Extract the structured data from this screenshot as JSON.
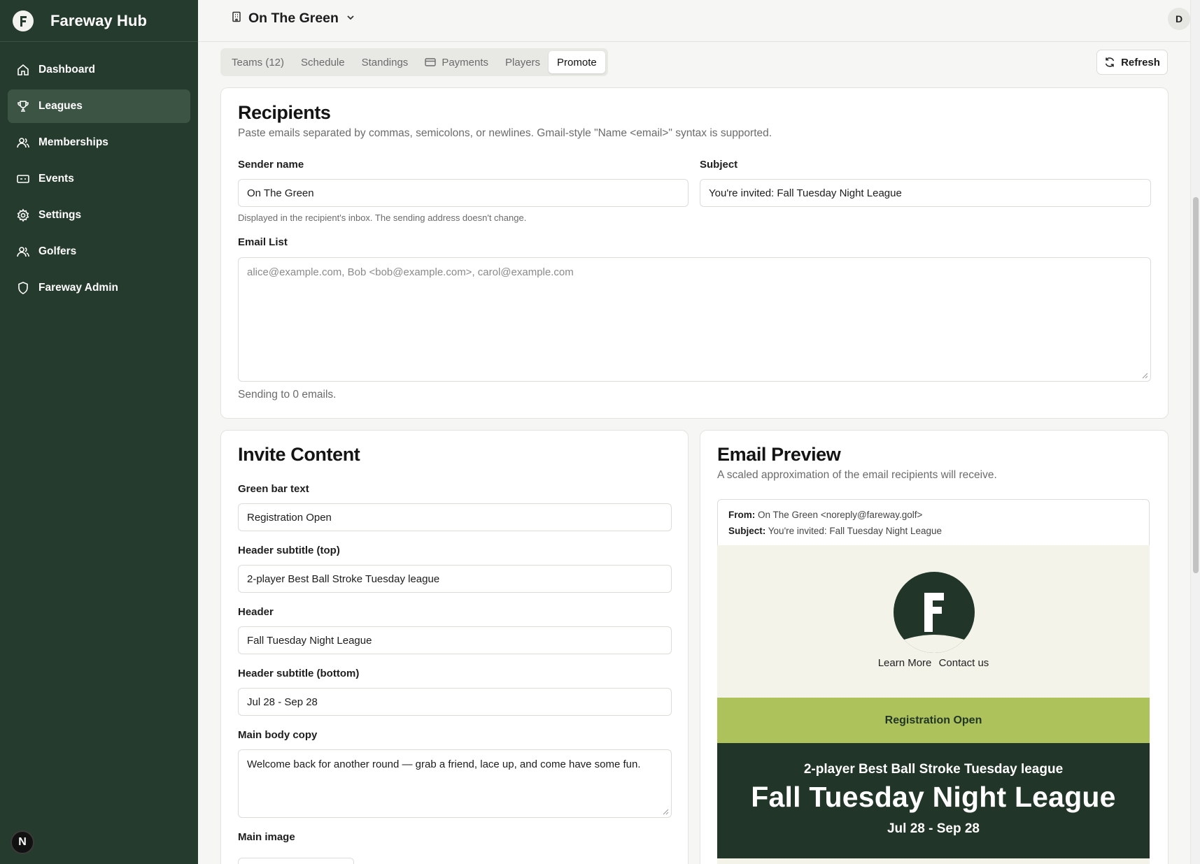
{
  "brand": {
    "name": "Fareway Hub",
    "logo_letter": "F"
  },
  "sidebar": {
    "items": [
      {
        "label": "Dashboard",
        "icon": "home-icon",
        "active": false
      },
      {
        "label": "Leagues",
        "icon": "trophy-icon",
        "active": true
      },
      {
        "label": "Memberships",
        "icon": "users-icon",
        "active": false
      },
      {
        "label": "Events",
        "icon": "ticket-icon",
        "active": false
      },
      {
        "label": "Settings",
        "icon": "gear-icon",
        "active": false
      },
      {
        "label": "Golfers",
        "icon": "users-icon",
        "active": false
      },
      {
        "label": "Fareway Admin",
        "icon": "shield-icon",
        "active": false
      }
    ],
    "badge": "N"
  },
  "topbar": {
    "org_name": "On The Green",
    "avatar_initial": "D"
  },
  "tabs": [
    {
      "label": "Teams (12)",
      "active": false
    },
    {
      "label": "Schedule",
      "active": false
    },
    {
      "label": "Standings",
      "active": false
    },
    {
      "label": "Payments",
      "active": false,
      "icon": "credit-card-icon"
    },
    {
      "label": "Players",
      "active": false
    },
    {
      "label": "Promote",
      "active": true
    }
  ],
  "refresh_label": "Refresh",
  "recipients": {
    "title": "Recipients",
    "description": "Paste emails separated by commas, semicolons, or newlines. Gmail-style \"Name <email>\" syntax is supported.",
    "sender_label": "Sender name",
    "sender_value": "On The Green",
    "sender_help": "Displayed in the recipient's inbox. The sending address doesn't change.",
    "subject_label": "Subject",
    "subject_value": "You're invited: Fall Tuesday Night League",
    "email_list_label": "Email List",
    "email_list_placeholder": "alice@example.com, Bob <bob@example.com>, carol@example.com",
    "sending_count": "Sending to 0 emails."
  },
  "invite": {
    "title": "Invite Content",
    "green_bar_label": "Green bar text",
    "green_bar_value": "Registration Open",
    "subtitle_top_label": "Header subtitle (top)",
    "subtitle_top_value": "2-player Best Ball Stroke Tuesday league",
    "header_label": "Header",
    "header_value": "Fall Tuesday Night League",
    "subtitle_bottom_label": "Header subtitle (bottom)",
    "subtitle_bottom_value": "Jul 28 - Sep 28",
    "body_label": "Main body copy",
    "body_value": "Welcome back for another round — grab a friend, lace up, and come have some fun.",
    "image_label": "Main image"
  },
  "preview": {
    "title": "Email Preview",
    "description": "A scaled approximation of the email recipients will receive.",
    "from_label": "From:",
    "from_value": "On The Green <noreply@fareway.golf>",
    "subject_label": "Subject:",
    "subject_value": "You're invited: Fall Tuesday Night League",
    "learn_more": "Learn More",
    "contact_us": "Contact us",
    "bar_text": "Registration Open",
    "hero_subtitle_top": "2-player Best Ball Stroke Tuesday league",
    "hero_title": "Fall Tuesday Night League",
    "hero_subtitle_bottom": "Jul 28 - Sep 28"
  },
  "colors": {
    "sidebar_bg": "#253b2d",
    "accent_green": "#adc25a",
    "hero_bg": "#213629"
  }
}
